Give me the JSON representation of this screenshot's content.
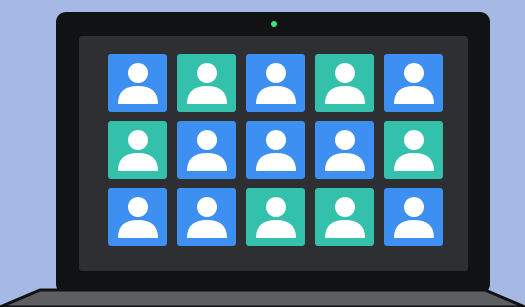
{
  "colors": {
    "background": "#a6b9e4",
    "laptop_frame": "#111214",
    "laptop_base": "#5c5e61",
    "laptop_base_edge": "#111214",
    "screen": "#2d2f33",
    "webcam": "#3ce37a",
    "tile_blue": "#3d8ff2",
    "tile_teal": "#33c1ac",
    "avatar": "#ffffff"
  },
  "icons": {
    "participant": "person-silhouette-icon",
    "camera": "webcam-light"
  },
  "participants": [
    {
      "color": "blue"
    },
    {
      "color": "teal"
    },
    {
      "color": "blue"
    },
    {
      "color": "teal"
    },
    {
      "color": "blue"
    },
    {
      "color": "teal"
    },
    {
      "color": "blue"
    },
    {
      "color": "blue"
    },
    {
      "color": "blue"
    },
    {
      "color": "teal"
    },
    {
      "color": "blue"
    },
    {
      "color": "blue"
    },
    {
      "color": "teal"
    },
    {
      "color": "teal"
    },
    {
      "color": "blue"
    }
  ]
}
